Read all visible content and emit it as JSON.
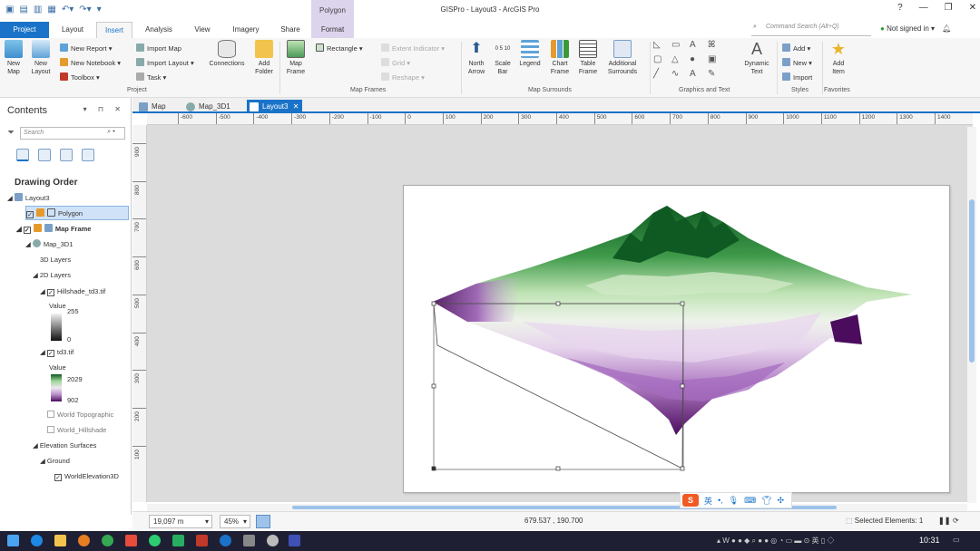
{
  "window": {
    "title": "GISPro - Layout3 - ArcGIS Pro",
    "context_tab_group": "Polygon",
    "controls": [
      "?",
      "—",
      "❐",
      "✕"
    ]
  },
  "ribbon_tabs": [
    "Project",
    "Layout",
    "Insert",
    "Analysis",
    "View",
    "Imagery",
    "Share",
    "Format"
  ],
  "command_search": {
    "placeholder": "Command Search (Alt+Q)"
  },
  "sign_in": "Not signed in",
  "ribbon": {
    "project": {
      "label": "Project",
      "new_map": "New\nMap",
      "new_layout": "New\nLayout",
      "new_report": "New Report",
      "new_notebook": "New Notebook",
      "toolbox": "Toolbox",
      "import_map": "Import Map",
      "import_layout": "Import Layout",
      "task": "Task",
      "connections": "Connections",
      "add_folder": "Add\nFolder"
    },
    "map_frames": {
      "label": "Map Frames",
      "map_frame": "Map\nFrame",
      "rectangle": "Rectangle",
      "extent_indicator": "Extent Indicator",
      "grid": "Grid",
      "reshape": "Reshape"
    },
    "map_surrounds": {
      "label": "Map Surrounds",
      "north_arrow": "North\nArrow",
      "scale_bar": "Scale\nBar",
      "legend": "Legend",
      "chart_frame": "Chart\nFrame",
      "table_frame": "Table\nFrame",
      "additional_surrounds": "Additional\nSurrounds",
      "scalebar_numbers": "0  5  10"
    },
    "graphics_text": {
      "label": "Graphics and Text",
      "dynamic_text": "Dynamic\nText"
    },
    "styles": {
      "label": "Styles",
      "add": "Add",
      "new": "New",
      "import": "Import"
    },
    "favorites": {
      "label": "Favorites",
      "add_item": "Add\nItem"
    }
  },
  "contents": {
    "title": "Contents",
    "controls": "▾ ⊓ ✕",
    "search_placeholder": "Search",
    "drawing_order": "Drawing Order",
    "tree": {
      "layout": "Layout3",
      "polygon": "Polygon",
      "map_frame": "Map Frame",
      "map": "Map_3D1",
      "layers_3d": "3D Layers",
      "layers_2d": "2D Layers",
      "hillshade": "Hillshade_td3.tif",
      "hillshade_value": "Value",
      "hillshade_max": "255",
      "hillshade_min": "0",
      "td3": "td3.tif",
      "td3_value": "Value",
      "td3_max": "2029",
      "td3_min": "902",
      "world_topo": "World Topographic",
      "world_hillshade": "World_Hillshade",
      "elevation_surfaces": "Elevation Surfaces",
      "ground": "Ground",
      "world_elevation": "WorldElevation3D"
    }
  },
  "doc_tabs": [
    "Map",
    "Map_3D1",
    "Layout3"
  ],
  "ruler": {
    "h": [
      "-600",
      "-500",
      "-400",
      "-300",
      "-200",
      "-100",
      "0",
      "100",
      "200",
      "300",
      "400",
      "500",
      "600",
      "700",
      "800",
      "900",
      "1000",
      "1100",
      "1200",
      "1300",
      "1400"
    ],
    "v": [
      "900",
      "800",
      "700",
      "600",
      "500",
      "400",
      "300",
      "200",
      "100"
    ]
  },
  "status": {
    "scale": "19,097 m",
    "zoom": "45%",
    "coords": "679.537 , 190.700",
    "selected": "Selected Elements: 1"
  },
  "ime": {
    "logo": "S",
    "lang": "英"
  },
  "taskbar": {
    "time": "10:31"
  },
  "colors": {
    "accent": "#1a73c8",
    "context_tab": "#dcd4ec",
    "terrain_high": "#0f5a23",
    "terrain_low": "#4b0c5e"
  }
}
